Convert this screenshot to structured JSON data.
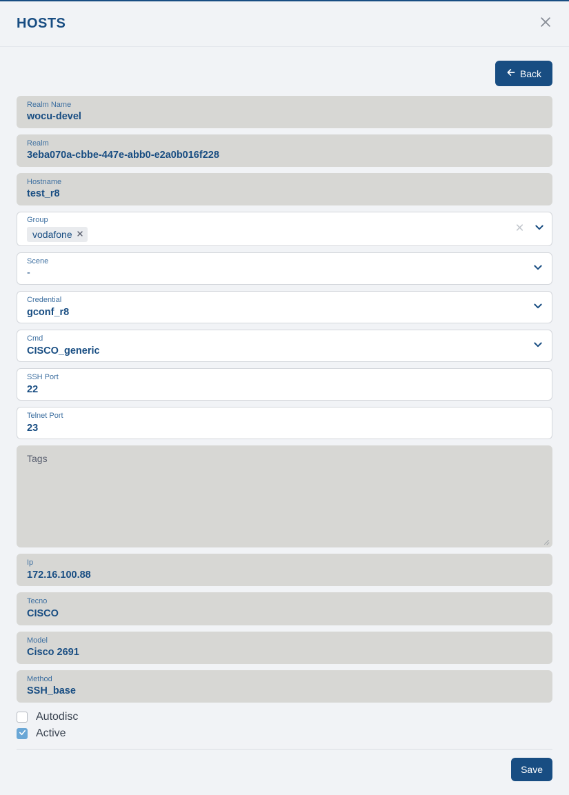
{
  "header": {
    "title": "HOSTS"
  },
  "toolbar": {
    "back_label": "Back"
  },
  "fields": {
    "realm_name": {
      "label": "Realm Name",
      "value": "wocu-devel"
    },
    "realm": {
      "label": "Realm",
      "value": "3eba070a-cbbe-447e-abb0-e2a0b016f228"
    },
    "hostname": {
      "label": "Hostname",
      "value": "test_r8"
    },
    "group": {
      "label": "Group",
      "chips": [
        "vodafone"
      ]
    },
    "scene": {
      "label": "Scene",
      "value": "-"
    },
    "credential": {
      "label": "Credential",
      "value": "gconf_r8"
    },
    "cmd": {
      "label": "Cmd",
      "value": "CISCO_generic"
    },
    "ssh_port": {
      "label": "SSH Port",
      "value": "22"
    },
    "telnet_port": {
      "label": "Telnet Port",
      "value": "23"
    },
    "tags": {
      "label": "Tags",
      "value": ""
    },
    "ip": {
      "label": "Ip",
      "value": "172.16.100.88"
    },
    "tecno": {
      "label": "Tecno",
      "value": "CISCO"
    },
    "model": {
      "label": "Model",
      "value": "Cisco 2691"
    },
    "method": {
      "label": "Method",
      "value": "SSH_base"
    }
  },
  "checkboxes": {
    "autodisc": {
      "label": "Autodisc",
      "checked": false
    },
    "active": {
      "label": "Active",
      "checked": true
    }
  },
  "footer": {
    "save_label": "Save"
  }
}
